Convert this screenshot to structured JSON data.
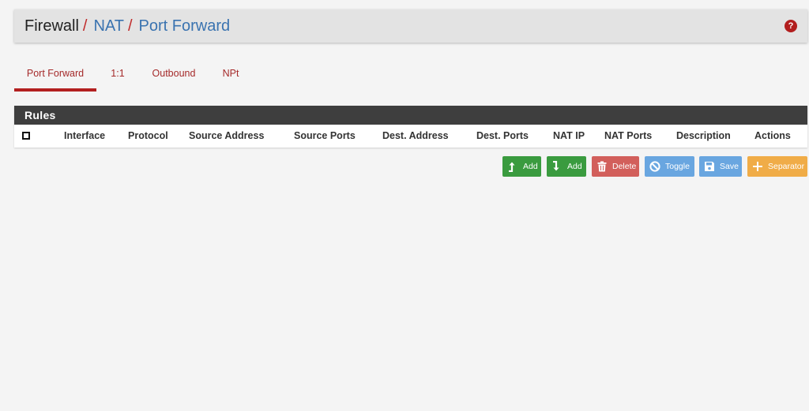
{
  "breadcrumb": {
    "firewall": "Firewall",
    "nat": "NAT",
    "current": "Port Forward",
    "separator": "/"
  },
  "help_icon": "?",
  "tabs": [
    {
      "label": "Port Forward",
      "active": true
    },
    {
      "label": "1:1",
      "active": false
    },
    {
      "label": "Outbound",
      "active": false
    },
    {
      "label": "NPt",
      "active": false
    }
  ],
  "panel": {
    "title": "Rules",
    "columns": [
      "Interface",
      "Protocol",
      "Source Address",
      "Source Ports",
      "Dest. Address",
      "Dest. Ports",
      "NAT IP",
      "NAT Ports",
      "Description",
      "Actions"
    ]
  },
  "buttons": {
    "add_top": "Add",
    "add_bottom": "Add",
    "delete": "Delete",
    "toggle": "Toggle",
    "save": "Save",
    "separator": "Separator"
  },
  "colors": {
    "success": "#3a9b3f",
    "danger": "#d25f5b",
    "info": "#69a6e0",
    "warning": "#f0ac47",
    "accent_red": "#b32020",
    "link_blue": "#3a73b0"
  }
}
